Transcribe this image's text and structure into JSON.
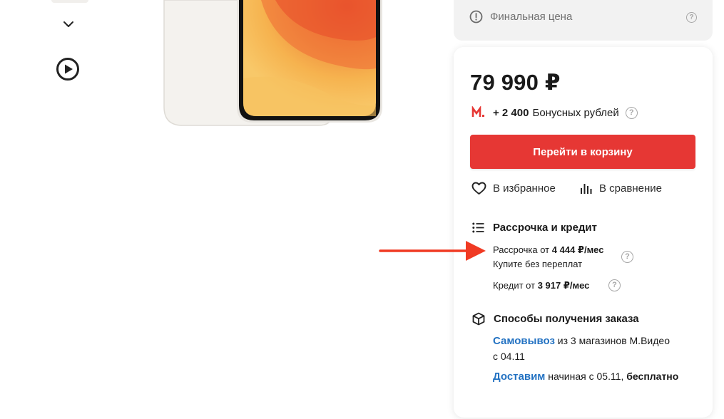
{
  "gallery": {
    "thumb_icons": [
      "chevron-down-icon",
      "play-icon"
    ]
  },
  "final_price": {
    "label": "Финальная цена"
  },
  "product": {
    "price": "79 990 ₽"
  },
  "bonus": {
    "amount": "+ 2 400",
    "label": "Бонусных рублей"
  },
  "actions": {
    "cart_button": "Перейти в корзину",
    "favorite": "В избранное",
    "compare": "В сравнение"
  },
  "credit": {
    "title": "Рассрочка и кредит",
    "installment_prefix": "Рассрочка от",
    "installment_value": "4 444 ₽/мес",
    "installment_note": "Купите без переплат",
    "credit_prefix": "Кредит от",
    "credit_value": "3 917 ₽/мес"
  },
  "delivery": {
    "title": "Способы получения заказа",
    "pickup_link": "Самовывоз",
    "pickup_text": "из 3 магазинов М.Видео",
    "pickup_date": "с 04.11",
    "delivery_link": "Доставим",
    "delivery_text": "начиная с 05.11,",
    "delivery_free": "бесплатно"
  },
  "colors": {
    "accent": "#e63734",
    "link": "#2372c2",
    "annotation_arrow": "#f03a23"
  }
}
